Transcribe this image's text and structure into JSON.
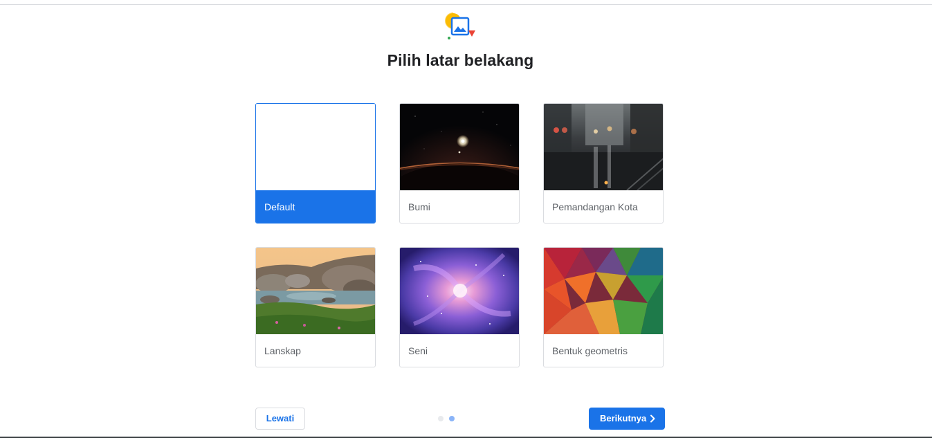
{
  "header": {
    "title": "Pilih latar belakang",
    "icon": "background-picker-icon"
  },
  "backgrounds": [
    {
      "label": "Default",
      "selected": true,
      "thumb": "blank"
    },
    {
      "label": "Bumi",
      "selected": false,
      "thumb": "earth-horizon"
    },
    {
      "label": "Pemandangan Kota",
      "selected": false,
      "thumb": "city-street-rain"
    },
    {
      "label": "Lanskap",
      "selected": false,
      "thumb": "rocky-coast"
    },
    {
      "label": "Seni",
      "selected": false,
      "thumb": "purple-galaxy"
    },
    {
      "label": "Bentuk geometris",
      "selected": false,
      "thumb": "colorful-polygons"
    }
  ],
  "footer": {
    "skip_label": "Lewati",
    "next_label": "Berikutnya",
    "step_total": 2,
    "step_current": 2
  },
  "colors": {
    "accent": "#1a73e8",
    "dot_active": "#8ab4f8",
    "dot_inactive": "#e8eaed"
  }
}
